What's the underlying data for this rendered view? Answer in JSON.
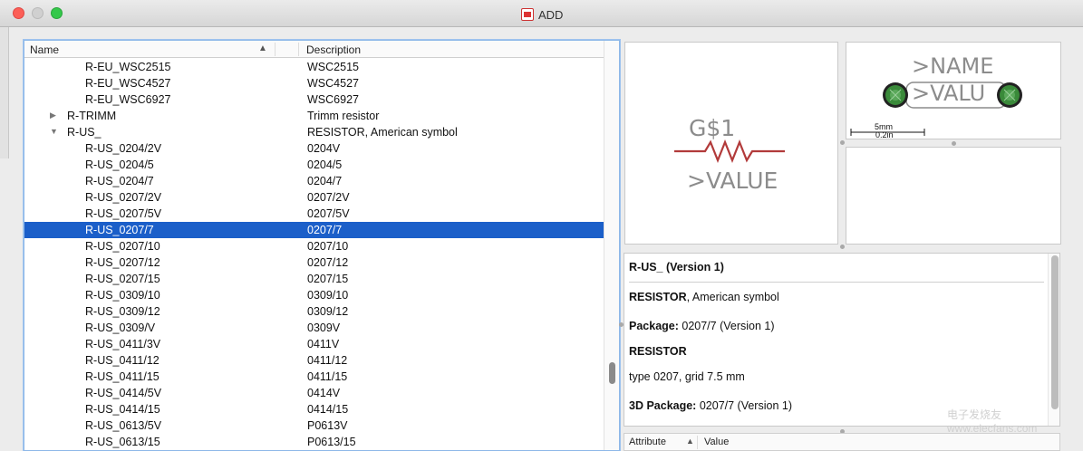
{
  "window": {
    "title": "ADD"
  },
  "tree": {
    "header_name": "Name",
    "header_desc": "Description",
    "rows": [
      {
        "name": "R-EU_WSC2515",
        "desc": "WSC2515",
        "indent": 2
      },
      {
        "name": "R-EU_WSC4527",
        "desc": "WSC4527",
        "indent": 2
      },
      {
        "name": "R-EU_WSC6927",
        "desc": "WSC6927",
        "indent": 2
      },
      {
        "name": "R-TRIMM",
        "desc": "Trimm resistor",
        "indent": 1,
        "expander": "▶"
      },
      {
        "name": "R-US_",
        "desc": "RESISTOR, American symbol",
        "indent": 1,
        "expander": "▼"
      },
      {
        "name": "R-US_0204/2V",
        "desc": "0204V",
        "indent": 2
      },
      {
        "name": "R-US_0204/5",
        "desc": "0204/5",
        "indent": 2
      },
      {
        "name": "R-US_0204/7",
        "desc": "0204/7",
        "indent": 2
      },
      {
        "name": "R-US_0207/2V",
        "desc": "0207/2V",
        "indent": 2
      },
      {
        "name": "R-US_0207/5V",
        "desc": "0207/5V",
        "indent": 2
      },
      {
        "name": "R-US_0207/7",
        "desc": "0207/7",
        "indent": 2,
        "selected": true
      },
      {
        "name": "R-US_0207/10",
        "desc": "0207/10",
        "indent": 2
      },
      {
        "name": "R-US_0207/12",
        "desc": "0207/12",
        "indent": 2
      },
      {
        "name": "R-US_0207/15",
        "desc": "0207/15",
        "indent": 2
      },
      {
        "name": "R-US_0309/10",
        "desc": "0309/10",
        "indent": 2
      },
      {
        "name": "R-US_0309/12",
        "desc": "0309/12",
        "indent": 2
      },
      {
        "name": "R-US_0309/V",
        "desc": "0309V",
        "indent": 2
      },
      {
        "name": "R-US_0411/3V",
        "desc": "0411V",
        "indent": 2
      },
      {
        "name": "R-US_0411/12",
        "desc": "0411/12",
        "indent": 2
      },
      {
        "name": "R-US_0411/15",
        "desc": "0411/15",
        "indent": 2
      },
      {
        "name": "R-US_0414/5V",
        "desc": "0414V",
        "indent": 2
      },
      {
        "name": "R-US_0414/15",
        "desc": "0414/15",
        "indent": 2
      },
      {
        "name": "R-US_0613/5V",
        "desc": "P0613V",
        "indent": 2
      },
      {
        "name": "R-US_0613/15",
        "desc": "P0613/15",
        "indent": 2
      }
    ]
  },
  "symbol": {
    "name": "G$1",
    "value": ">VALUE"
  },
  "package": {
    "name": ">NAME",
    "value": ">VALU",
    "scale_mm": "5mm",
    "scale_in": "0.2in"
  },
  "info": {
    "title": "R-US_ (Version 1)",
    "desc_bold": "RESISTOR",
    "desc_rest": ", American symbol",
    "package_label": "Package:",
    "package_value": " 0207/7 (Version 1)",
    "section": "RESISTOR",
    "detail": "type 0207, grid 7.5 mm",
    "pkg3d_label": "3D Package:",
    "pkg3d_value": " 0207/7 (Version 1)"
  },
  "attributes": {
    "col_attr": "Attribute",
    "col_value": "Value"
  },
  "watermark": "电子发烧友 www.elecfans.com",
  "colors": {
    "selection": "#1b5fc9",
    "resistor": "#b23a3a",
    "pad": "#3a8a3a"
  }
}
